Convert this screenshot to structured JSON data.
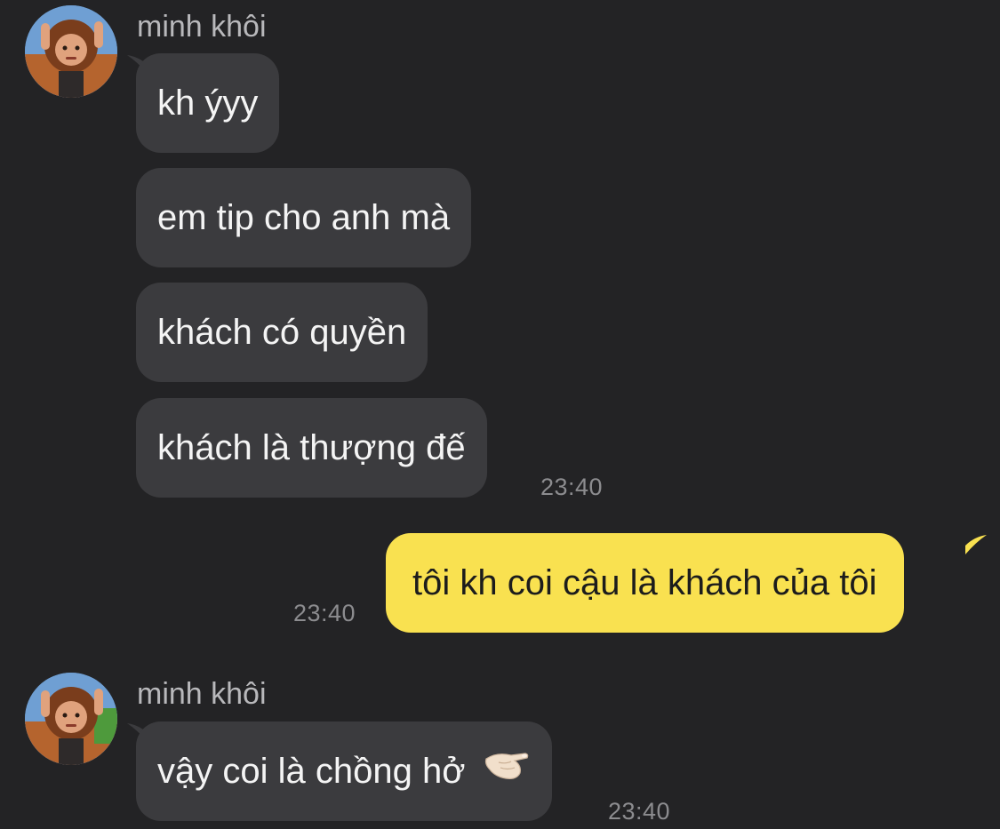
{
  "colors": {
    "background": "#232325",
    "incoming_bubble": "#3b3b3e",
    "outgoing_bubble": "#f9e150",
    "timestamp": "#8c8c8f",
    "sender_name": "#b8b8bb"
  },
  "groups": [
    {
      "sender": "minh khôi",
      "messages": [
        "kh ýyy",
        "em tip cho anh mà",
        "khách có quyền",
        "khách là thượng đế"
      ],
      "time": "23:40"
    },
    {
      "outgoing": true,
      "messages": [
        "tôi kh coi cậu là khách của tôi"
      ],
      "time": "23:40"
    },
    {
      "sender": "minh khôi",
      "messages": [
        "vậy coi là chồng hở"
      ],
      "emoji": "pinching-hand-emoji",
      "time": "23:40"
    }
  ]
}
